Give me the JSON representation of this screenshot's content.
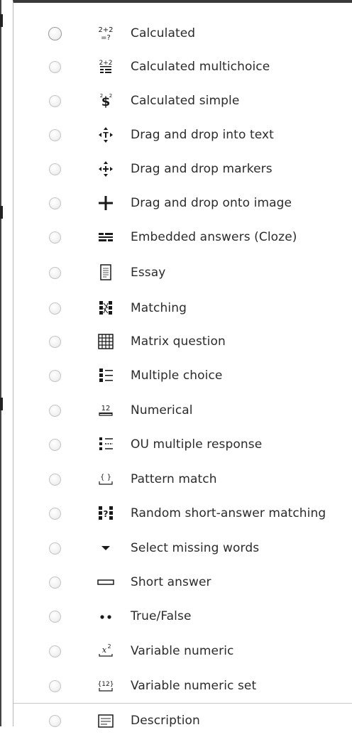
{
  "question_types": [
    {
      "label": "Calculated",
      "icon": "calculated-icon"
    },
    {
      "label": "Calculated multichoice",
      "icon": "calculated-multichoice-icon"
    },
    {
      "label": "Calculated simple",
      "icon": "calculated-simple-icon"
    },
    {
      "label": "Drag and drop into text",
      "icon": "drag-drop-text-icon"
    },
    {
      "label": "Drag and drop markers",
      "icon": "drag-drop-markers-icon"
    },
    {
      "label": "Drag and drop onto image",
      "icon": "drag-drop-image-icon"
    },
    {
      "label": "Embedded answers (Cloze)",
      "icon": "cloze-icon"
    },
    {
      "label": "Essay",
      "icon": "essay-icon"
    },
    {
      "label": "Matching",
      "icon": "matching-icon"
    },
    {
      "label": "Matrix question",
      "icon": "matrix-icon"
    },
    {
      "label": "Multiple choice",
      "icon": "multiple-choice-icon"
    },
    {
      "label": "Numerical",
      "icon": "numerical-icon"
    },
    {
      "label": "OU multiple response",
      "icon": "ou-multiple-response-icon"
    },
    {
      "label": "Pattern match",
      "icon": "pattern-match-icon"
    },
    {
      "label": "Random short-answer matching",
      "icon": "random-short-answer-icon"
    },
    {
      "label": "Select missing words",
      "icon": "select-missing-words-icon"
    },
    {
      "label": "Short answer",
      "icon": "short-answer-icon"
    },
    {
      "label": "True/False",
      "icon": "true-false-icon"
    },
    {
      "label": "Variable numeric",
      "icon": "variable-numeric-icon"
    },
    {
      "label": "Variable numeric set",
      "icon": "variable-numeric-set-icon"
    }
  ],
  "other_types": [
    {
      "label": "Description",
      "icon": "description-icon"
    }
  ],
  "icon_text": {
    "calculated_top": "2+2",
    "calculated_bottom": "=?",
    "numerical": "12",
    "pattern": "{ }",
    "variable_numeric": "x",
    "variable_numeric_sup": "2",
    "variable_numeric_set": "{12}"
  }
}
